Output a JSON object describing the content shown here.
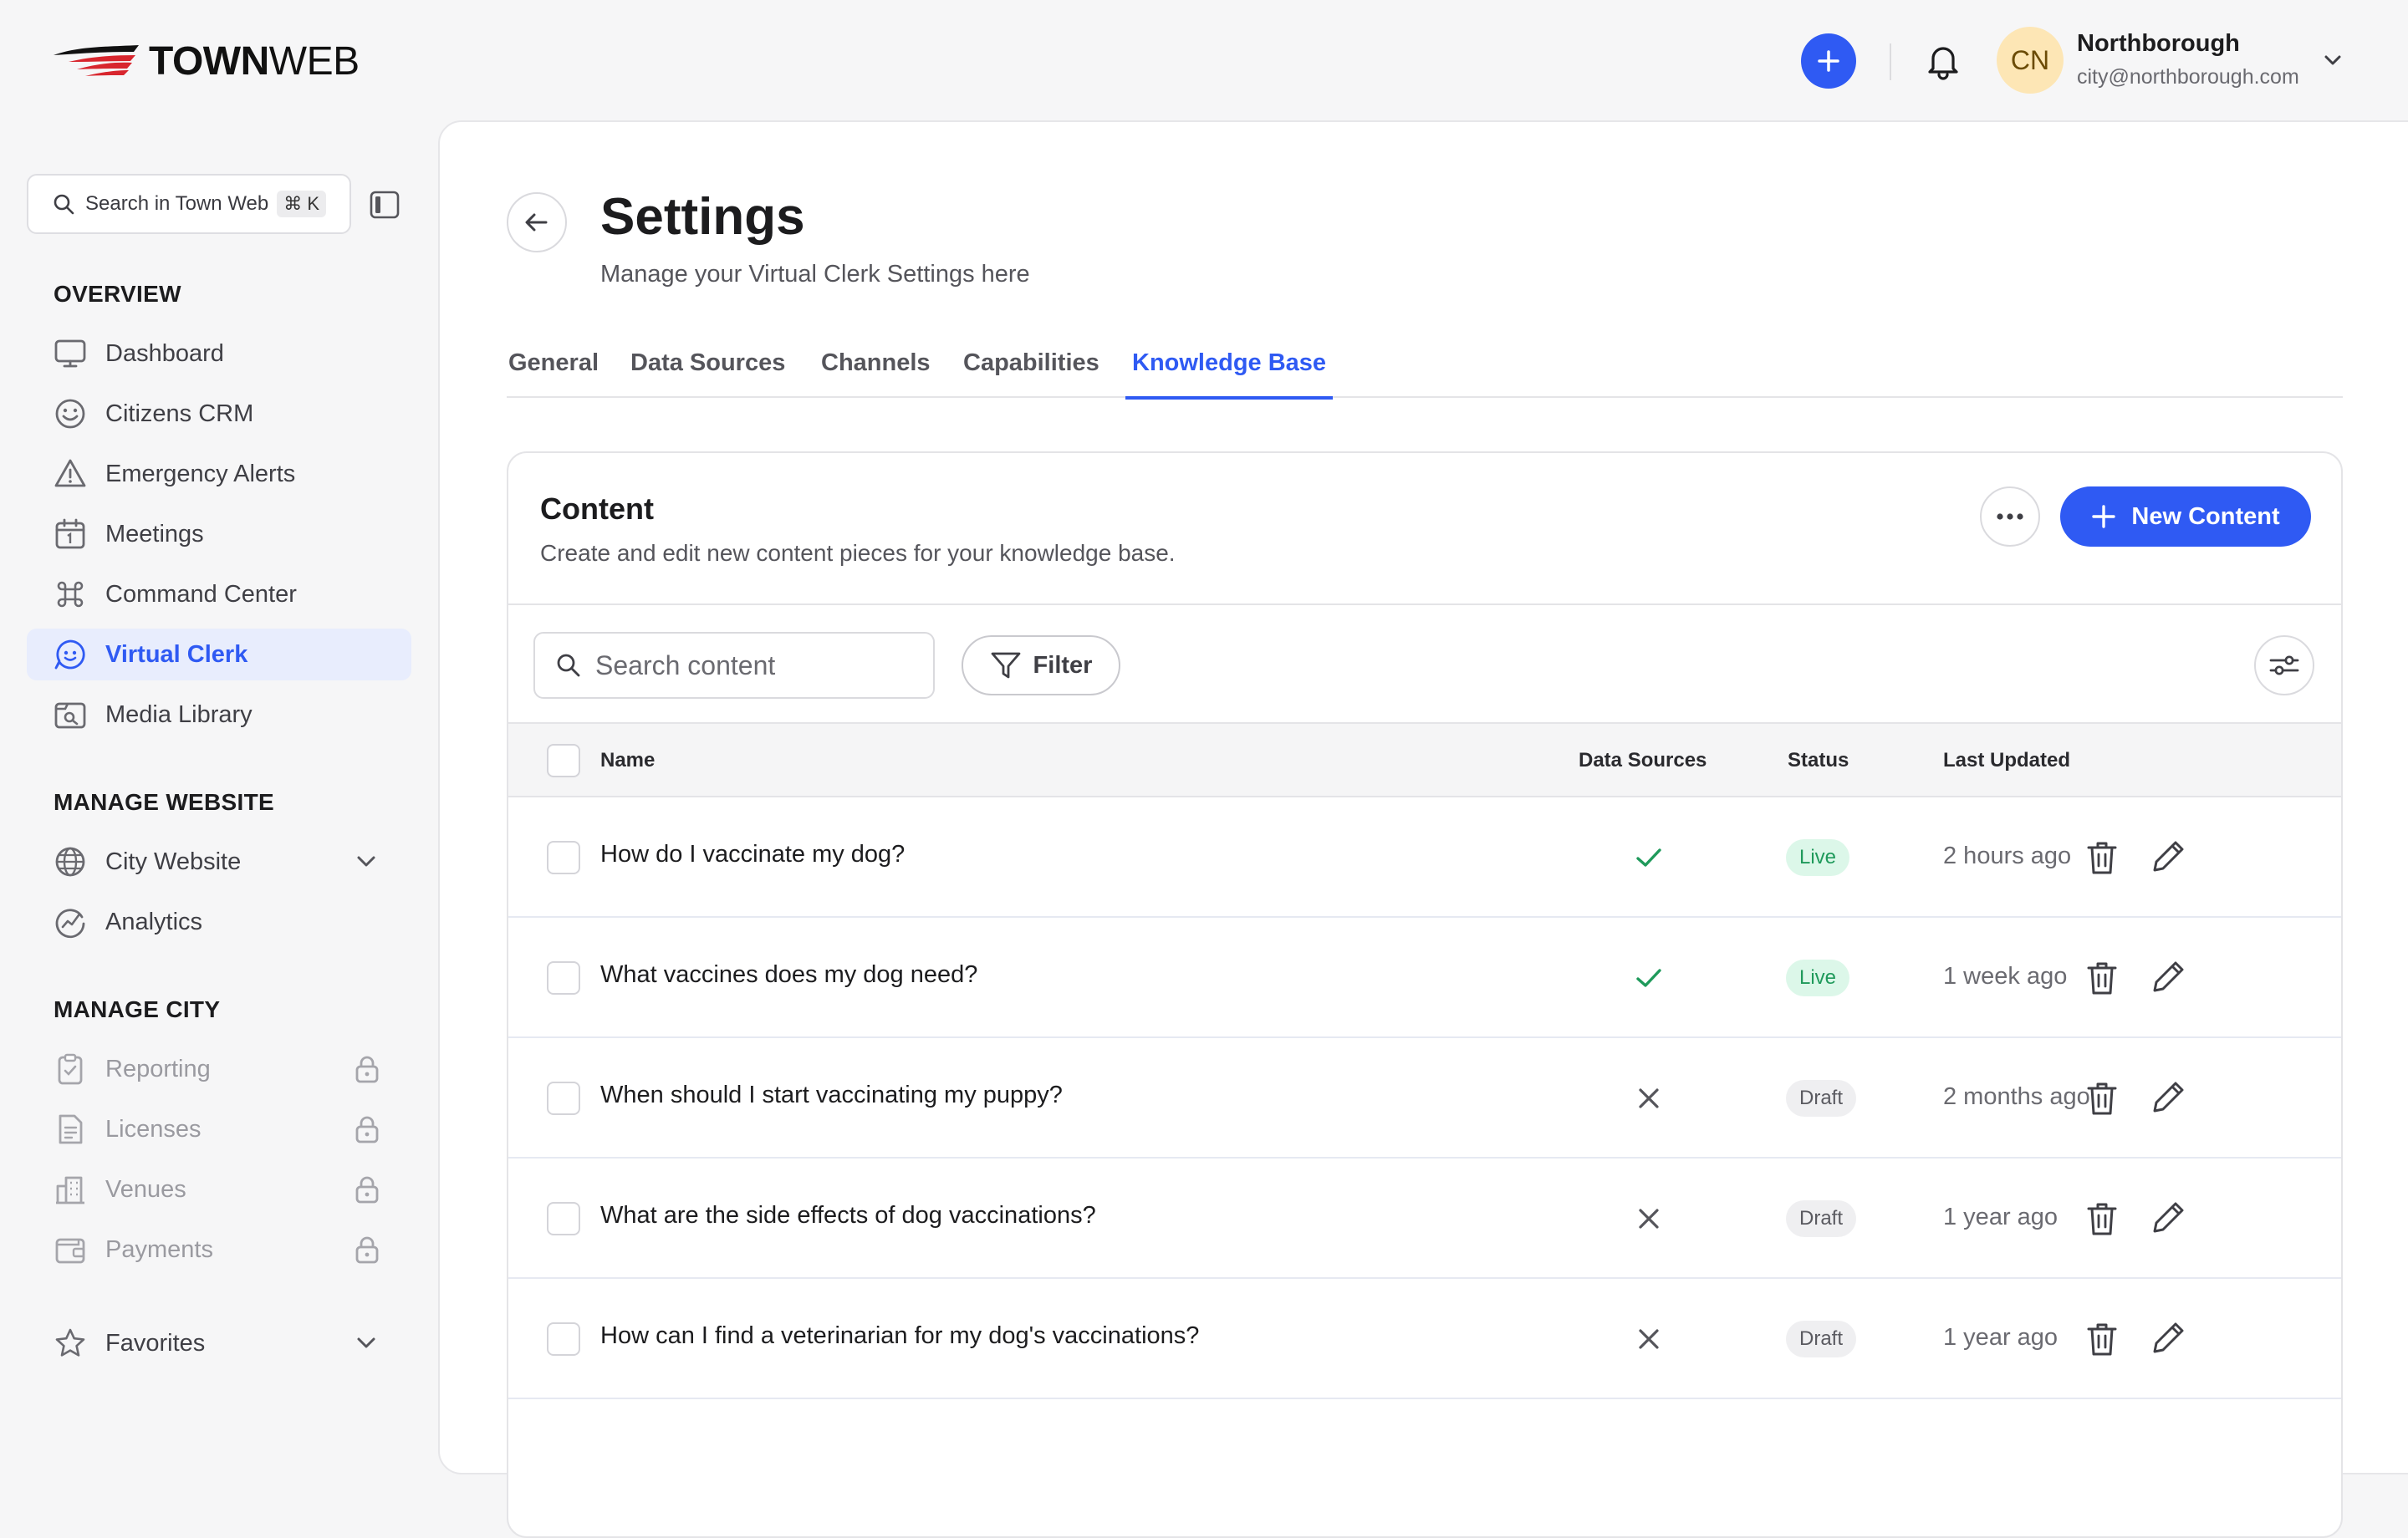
{
  "app": {
    "logo_bold": "TOWN",
    "logo_light": "WEB",
    "org_name": "Northborough",
    "org_email": "city@northborough.com",
    "avatar_initials": "CN"
  },
  "sidebar": {
    "search_placeholder": "Search in Town Web",
    "search_shortcut": "⌘ K",
    "sections": {
      "overview": "OVERVIEW",
      "manage_website": "MANAGE WEBSITE",
      "manage_city": "MANAGE CITY"
    },
    "overview_items": [
      {
        "label": "Dashboard",
        "icon": "monitor-icon"
      },
      {
        "label": "Citizens CRM",
        "icon": "smile-icon"
      },
      {
        "label": "Emergency Alerts",
        "icon": "alert-triangle-icon"
      },
      {
        "label": "Meetings",
        "icon": "calendar-icon"
      },
      {
        "label": "Command Center",
        "icon": "command-icon"
      },
      {
        "label": "Virtual Clerk",
        "icon": "chat-bot-icon",
        "active": true
      },
      {
        "label": "Media Library",
        "icon": "image-search-icon"
      }
    ],
    "website_items": [
      {
        "label": "City Website",
        "icon": "globe-icon"
      },
      {
        "label": "Analytics",
        "icon": "analytics-icon"
      }
    ],
    "city_items": [
      {
        "label": "Reporting",
        "icon": "clipboard-check-icon",
        "locked": true
      },
      {
        "label": "Licenses",
        "icon": "document-icon",
        "locked": true
      },
      {
        "label": "Venues",
        "icon": "building-icon",
        "locked": true
      },
      {
        "label": "Payments",
        "icon": "wallet-icon",
        "locked": true
      }
    ],
    "favorites_label": "Favorites"
  },
  "page": {
    "title": "Settings",
    "subtitle": "Manage your Virtual Clerk Settings here",
    "tabs": [
      "General",
      "Data Sources",
      "Channels",
      "Capabilities",
      "Knowledge Base"
    ],
    "active_tab": "Knowledge Base"
  },
  "content": {
    "title": "Content",
    "subtitle": "Create and edit new content pieces for your knowledge base.",
    "new_button": "New Content",
    "search_placeholder": "Search content",
    "filter_label": "Filter",
    "columns": {
      "name": "Name",
      "data_sources": "Data Sources",
      "status": "Status",
      "last_updated": "Last Updated"
    },
    "rows": [
      {
        "name": "How do I vaccinate my dog?",
        "data_source": true,
        "status": "Live",
        "updated": "2 hours ago"
      },
      {
        "name": "What vaccines does my dog need?",
        "data_source": true,
        "status": "Live",
        "updated": "1 week ago"
      },
      {
        "name": "When should I start vaccinating my puppy?",
        "data_source": false,
        "status": "Draft",
        "updated": "2 months ago"
      },
      {
        "name": "What are the side effects of dog vaccinations?",
        "data_source": false,
        "status": "Draft",
        "updated": "1 year ago"
      },
      {
        "name": "How can I find a veterinarian for my dog's vaccinations?",
        "data_source": false,
        "status": "Draft",
        "updated": "1 year ago"
      }
    ]
  },
  "colors": {
    "accent": "#2f5af3",
    "live_bg": "#dcf7e9",
    "live_text": "#1f9a5b",
    "draft_bg": "#efeff1",
    "avatar_bg": "#fde6b5"
  }
}
